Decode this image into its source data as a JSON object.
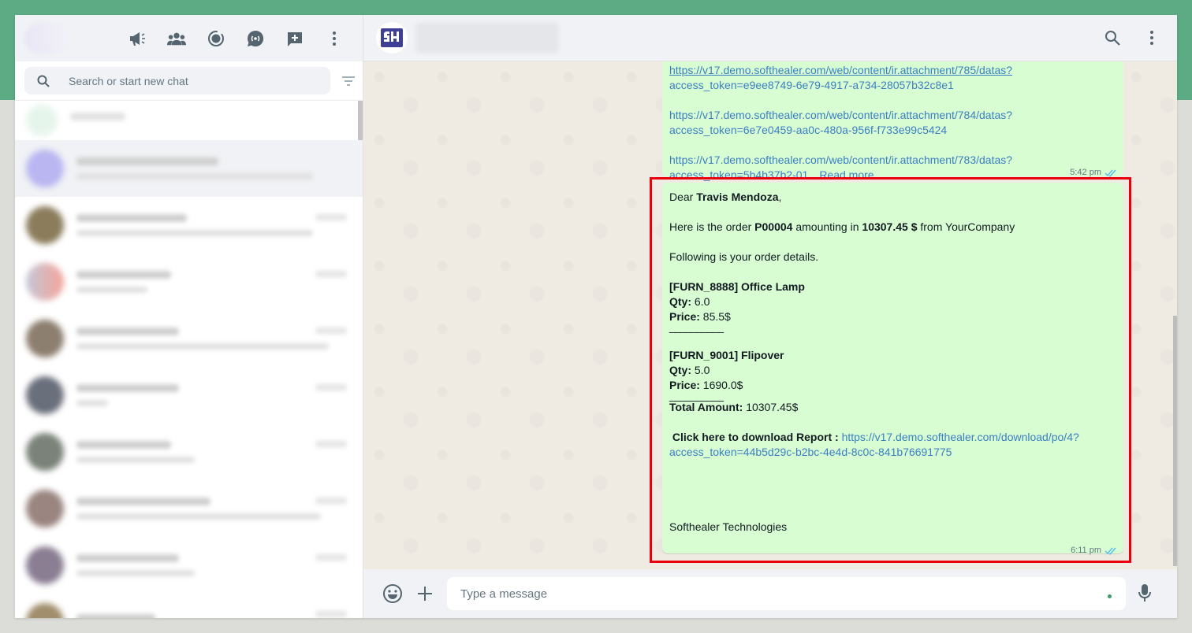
{
  "sidebar": {
    "header_icons": [
      "megaphone-icon",
      "community-icon",
      "status-icon",
      "channels-icon",
      "new-chat-icon",
      "menu-icon"
    ],
    "search": {
      "placeholder": "Search or start new chat"
    }
  },
  "message_prev": {
    "links": [
      "https://v17.demo.softhealer.com/web/content/ir.attachment/785/datas?access_token=e9ee8749-6e79-4917-a734-28057b32c8e1",
      "https://v17.demo.softhealer.com/web/content/ir.attachment/784/datas?access_token=6e7e0459-aa0c-480a-956f-f733e99c5424",
      "https://v17.demo.softhealer.com/web/content/ir.attachment/783/datas?access_token=5b4b37b2-01"
    ],
    "line1a": "https://v17.demo.softhealer.com/web/content/ir.attachment/785/datas?",
    "line1b": "access_token=e9ee8749-6e79-4917-a734-28057b32c8e1",
    "line2a": "https://v17.demo.softhealer.com/web/content/ir.attachment/784/datas?",
    "line2b": "access_token=6e7e0459-aa0c-480a-956f-f733e99c5424",
    "line3a": "https://v17.demo.softhealer.com/web/content/ir.attachment/783/datas?",
    "line3b": "access_token=5b4b37b2-01",
    "ellipsis": "…",
    "read_more": "Read more",
    "time": "5:42 pm"
  },
  "message": {
    "greeting_prefix": "Dear ",
    "customer": "Travis Mendoza",
    "greeting_suffix": ",",
    "order_prefix": "Here is the order ",
    "order_id": "P00004",
    "order_mid": " amounting in ",
    "amount": "10307.45 $",
    "order_suffix": " from YourCompany",
    "details_intro": "Following is your order details.",
    "items": [
      {
        "name": "[FURN_8888] Office Lamp",
        "qty_label": "Qty:",
        "qty": " 6.0",
        "price_label": "Price:",
        "price": " 85.5$"
      },
      {
        "name": "[FURN_9001] Flipover",
        "qty_label": "Qty:",
        "qty": " 5.0",
        "price_label": "Price:",
        "price": " 1690.0$"
      }
    ],
    "separator": "__________",
    "total_label": "Total Amount:",
    "total_value": " 10307.45$",
    "download_label": "Click here to download Report :",
    "download_link_a": "https://v17.demo.softhealer.com/download/po/4?",
    "download_link_b": "access_token=44b5d29c-b2bc-4e4d-8c0c-841b76691775",
    "signature": "Softhealer Technologies",
    "time": "6:11 pm"
  },
  "composer": {
    "placeholder": "Type a message"
  },
  "colors": {
    "header_band": "#5dab85",
    "bubble": "#d9fdd3",
    "link": "#3a7fc1",
    "highlight": "#e8000b",
    "read_ticks": "#53bdeb"
  }
}
